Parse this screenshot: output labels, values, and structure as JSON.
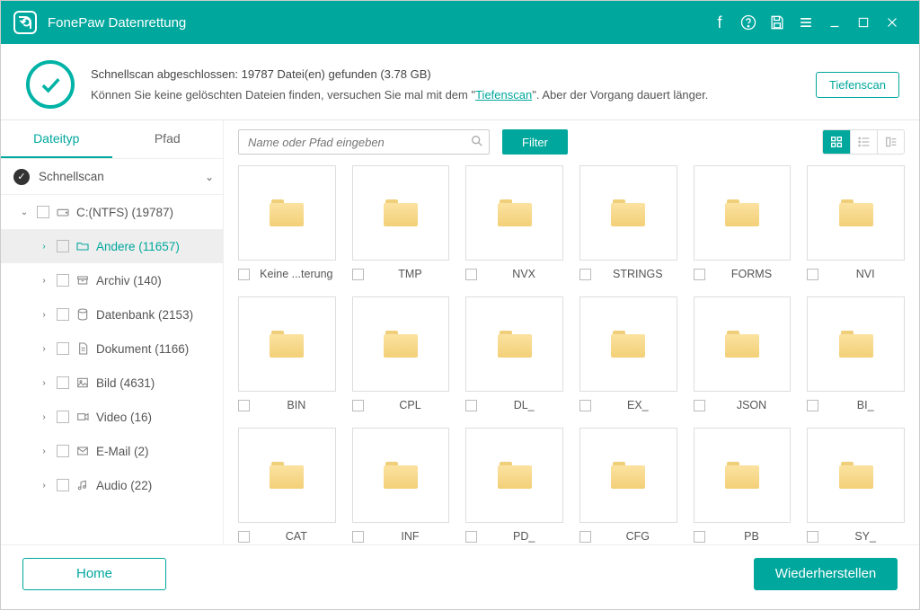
{
  "app": {
    "name": "FonePaw Datenrettung"
  },
  "status": {
    "line1": "Schnellscan abgeschlossen: 19787 Datei(en) gefunden (3.78 GB)",
    "line2_a": "Können Sie keine gelöschten Dateien finden, versuchen Sie mal mit dem \"",
    "deep_link": "Tiefenscan",
    "line2_b": "\". Aber der Vorgang dauert länger.",
    "deep_button": "Tiefenscan"
  },
  "sidebar": {
    "tabs": {
      "type": "Dateityp",
      "path": "Pfad"
    },
    "root": "Schnellscan",
    "drive": "C:(NTFS) (19787)",
    "items": [
      {
        "label": "Andere (11657)"
      },
      {
        "label": "Archiv (140)"
      },
      {
        "label": "Datenbank (2153)"
      },
      {
        "label": "Dokument (1166)"
      },
      {
        "label": "Bild (4631)"
      },
      {
        "label": "Video (16)"
      },
      {
        "label": "E-Mail (2)"
      },
      {
        "label": "Audio (22)"
      }
    ]
  },
  "toolbar": {
    "search_placeholder": "Name oder Pfad eingeben",
    "filter": "Filter"
  },
  "grid": [
    {
      "name": "Keine ...terung"
    },
    {
      "name": "TMP"
    },
    {
      "name": "NVX"
    },
    {
      "name": "STRINGS"
    },
    {
      "name": "FORMS"
    },
    {
      "name": "NVI"
    },
    {
      "name": "BIN"
    },
    {
      "name": "CPL"
    },
    {
      "name": "DL_"
    },
    {
      "name": "EX_"
    },
    {
      "name": "JSON"
    },
    {
      "name": "BI_"
    },
    {
      "name": "CAT"
    },
    {
      "name": "INF"
    },
    {
      "name": "PD_"
    },
    {
      "name": "CFG"
    },
    {
      "name": "PB"
    },
    {
      "name": "SY_"
    }
  ],
  "footer": {
    "home": "Home",
    "recover": "Wiederherstellen"
  }
}
